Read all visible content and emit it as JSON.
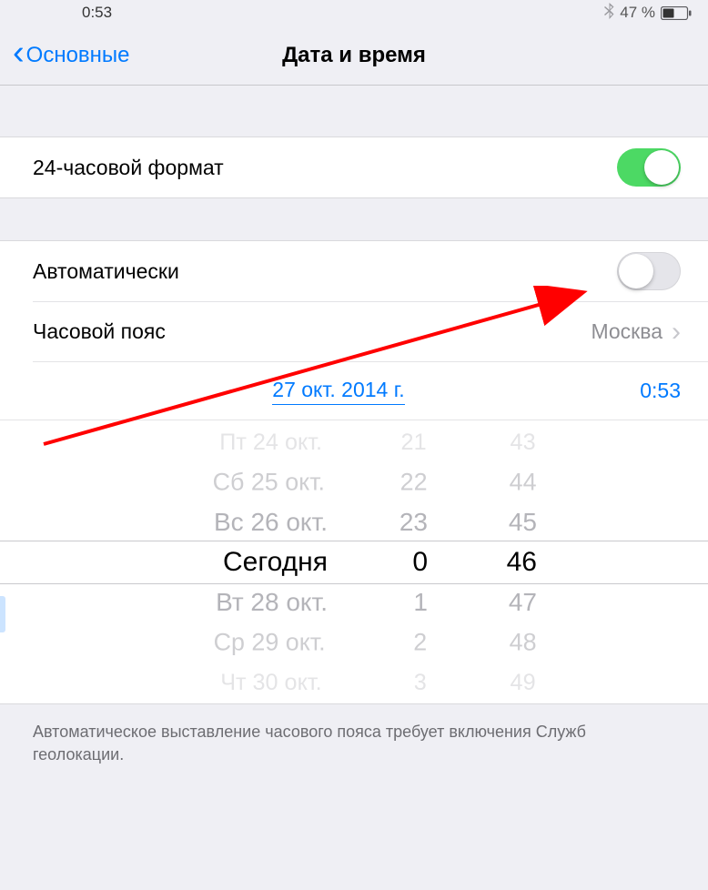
{
  "status": {
    "time": "0:53",
    "battery_percent": "47 %",
    "bluetooth_glyph": "฿"
  },
  "nav": {
    "back_label": "Основные",
    "title": "Дата и время"
  },
  "settings": {
    "format_24h": {
      "label": "24-часовой формат",
      "on": true
    },
    "automatic": {
      "label": "Автоматически",
      "on": false
    },
    "timezone": {
      "label": "Часовой пояс",
      "value": "Москва"
    },
    "selected_date": "27 окт. 2014 г.",
    "selected_time": "0:53"
  },
  "picker": {
    "date": [
      "Пт 24 окт.",
      "Сб 25 окт.",
      "Вс 26 окт.",
      "Сегодня",
      "Вт 28 окт.",
      "Ср 29 окт.",
      "Чт 30 окт."
    ],
    "hour": [
      "21",
      "22",
      "23",
      "0",
      "1",
      "2",
      "3"
    ],
    "minute": [
      "43",
      "44",
      "45",
      "46",
      "47",
      "48",
      "49"
    ]
  },
  "footer": {
    "note": "Автоматическое выставление часового пояса требует включения Служб геолокации."
  }
}
